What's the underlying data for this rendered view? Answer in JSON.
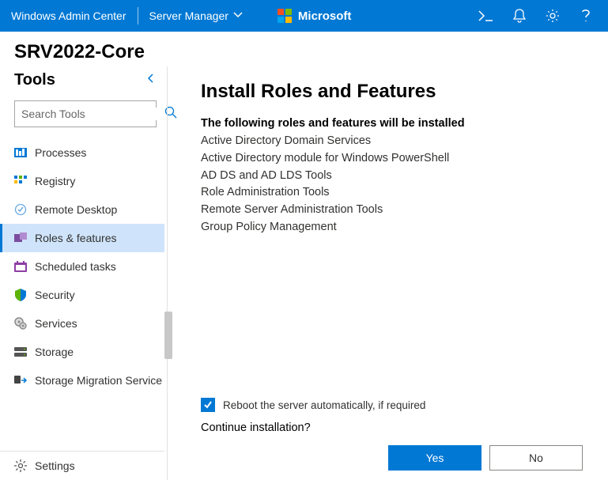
{
  "topbar": {
    "product": "Windows Admin Center",
    "module": "Server Manager",
    "brand": "Microsoft"
  },
  "server": {
    "name": "SRV2022-Core"
  },
  "sidebar": {
    "title": "Tools",
    "search_placeholder": "Search Tools",
    "items": [
      {
        "label": "Processes"
      },
      {
        "label": "Registry"
      },
      {
        "label": "Remote Desktop"
      },
      {
        "label": "Roles & features"
      },
      {
        "label": "Scheduled tasks"
      },
      {
        "label": "Security"
      },
      {
        "label": "Services"
      },
      {
        "label": "Storage"
      },
      {
        "label": "Storage Migration Service"
      },
      {
        "label": "Settings"
      }
    ],
    "selected_index": 3
  },
  "content": {
    "title": "Install Roles and Features",
    "subhead": "The following roles and features will be installed",
    "features": [
      "Active Directory Domain Services",
      "Active Directory module for Windows PowerShell",
      "AD DS and AD LDS Tools",
      "Role Administration Tools",
      "Remote Server Administration Tools",
      "Group Policy Management"
    ],
    "reboot_label": "Reboot the server automatically, if required",
    "reboot_checked": true,
    "continue_label": "Continue installation?",
    "yes_label": "Yes",
    "no_label": "No"
  }
}
